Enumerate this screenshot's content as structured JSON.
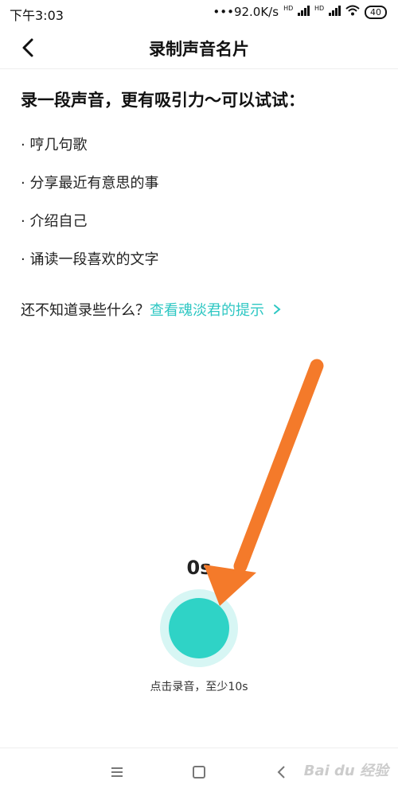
{
  "status_bar": {
    "time": "下午3:03",
    "network_speed": "•••92.0K/s",
    "hd_label": "HD",
    "battery": "40",
    "icons": [
      "signal-icon",
      "signal-icon",
      "wifi-icon",
      "battery-icon"
    ]
  },
  "header": {
    "title": "录制声音名片",
    "back_icon": "chevron-left-icon"
  },
  "content": {
    "heading": "录一段声音，更有吸引力～可以试试：",
    "suggestions": [
      "· 哼几句歌",
      "· 分享最近有意思的事",
      "· 介绍自己",
      "· 诵读一段喜欢的文字"
    ],
    "hint_question": "还不知道录些什么？",
    "hint_link": "查看魂淡君的提示",
    "hint_link_icon": "chevron-right-icon"
  },
  "recorder": {
    "timer": "0s",
    "hint": "点击录音，至少10s"
  },
  "nav_bar": {
    "icons": [
      "menu-icon",
      "home-icon",
      "back-icon"
    ]
  },
  "watermark": "Bai du 经验",
  "colors": {
    "accent": "#2ec7c3",
    "record_button": "#2fd3c6",
    "record_halo": "#d7f6f4",
    "annotation_arrow": "#f47a2a"
  }
}
